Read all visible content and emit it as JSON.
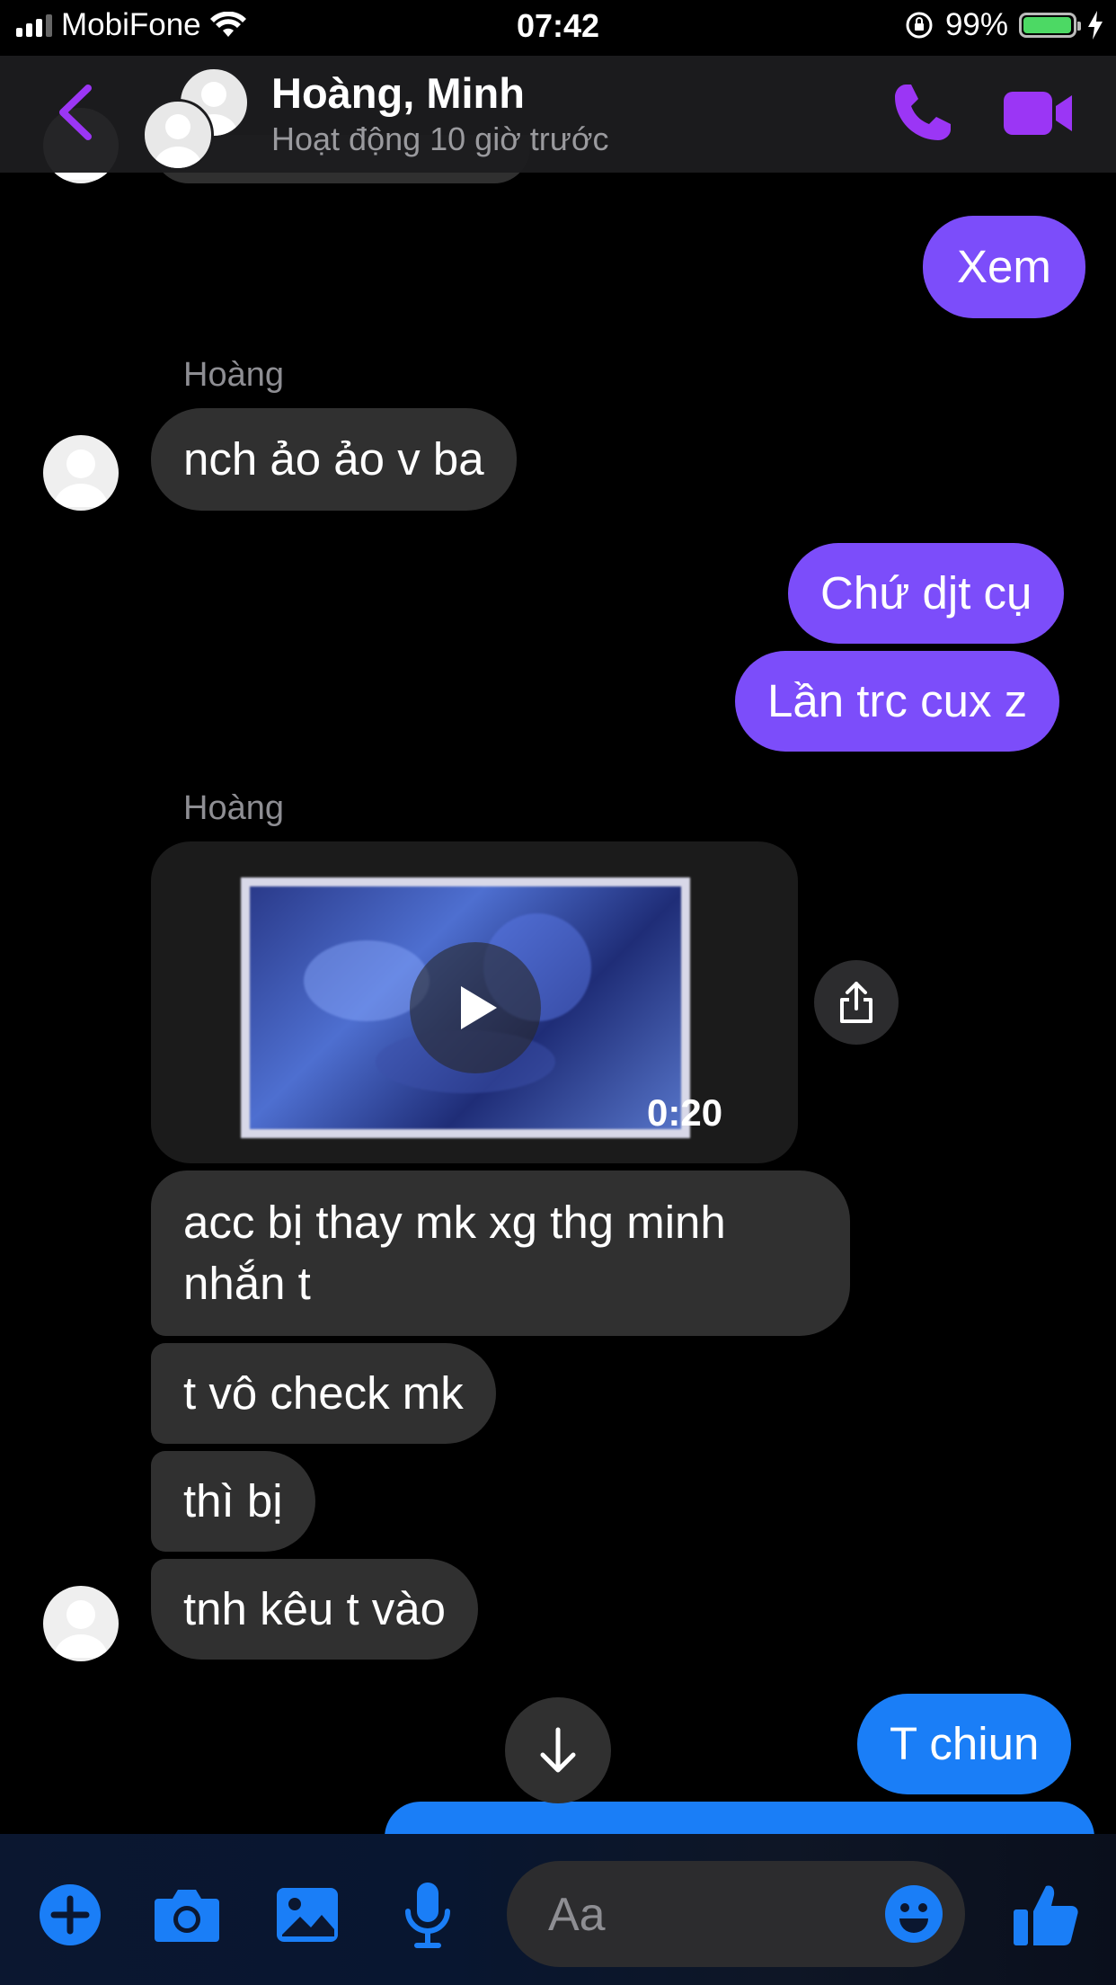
{
  "status_bar": {
    "carrier": "MobiFone",
    "time": "07:42",
    "battery": "99%",
    "battery_level": 0.99
  },
  "header": {
    "title": "Hoàng, Minh",
    "subtitle": "Hoạt động 10 giờ trước",
    "back_icon": "chevron-left-icon",
    "call_icon": "phone-icon",
    "video_icon": "video-camera-icon",
    "accent_color": "#9b36f5"
  },
  "messages": [
    {
      "from": "me",
      "text": "Xem"
    },
    {
      "from": "Hoàng",
      "sender_label": "Hoàng",
      "text": "nch ảo ảo v ba"
    },
    {
      "from": "me",
      "text": "Chứ djt cụ"
    },
    {
      "from": "me",
      "text": "Lần trc cux z"
    },
    {
      "from": "Hoàng",
      "sender_label": "Hoàng",
      "type": "video",
      "duration": "0:20"
    },
    {
      "from": "Hoàng",
      "text": "acc bị thay mk xg thg minh\nnhắn t"
    },
    {
      "from": "Hoàng",
      "text": "t vô check mk"
    },
    {
      "from": "Hoàng",
      "text": "thì bị"
    },
    {
      "from": "Hoàng",
      "text": "tnh kêu t vào"
    },
    {
      "from": "me",
      "text": "T chiun"
    }
  ],
  "composer": {
    "placeholder": "Aa",
    "icons": [
      "plus-icon",
      "camera-icon",
      "gallery-icon",
      "microphone-icon",
      "emoji-icon",
      "thumbs-up-icon"
    ],
    "accent_color": "#1a7ef7"
  },
  "colors": {
    "incoming_bubble": "#303030",
    "outgoing_purple": "#7c4dfa",
    "outgoing_blue": "#1a7ef7"
  }
}
